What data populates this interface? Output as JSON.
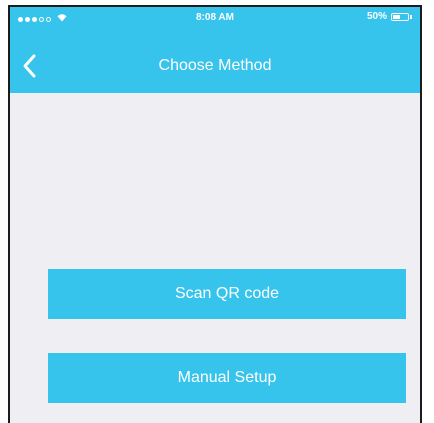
{
  "status_bar": {
    "time": "8:08 AM",
    "battery_percent": "50%",
    "battery_level": 0.5,
    "signal_bars_filled": 3,
    "signal_bars_total": 5
  },
  "nav": {
    "title": "Choose Method",
    "back_icon": "chevron-left-icon"
  },
  "actions": {
    "scan_label": "Scan QR code",
    "manual_label": "Manual Setup"
  },
  "colors": {
    "accent": "#36c4ec",
    "background": "#efeef3",
    "text_on_accent": "#ffffff"
  }
}
